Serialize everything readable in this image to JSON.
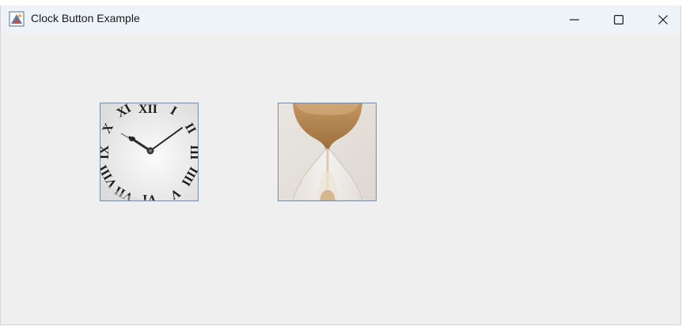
{
  "window": {
    "title": "Clock Button Example",
    "icon": "java-app-icon",
    "controls": [
      "minimize-icon",
      "maximize-icon",
      "close-icon"
    ]
  },
  "content": {
    "buttons": [
      {
        "name": "clock-button",
        "icon": "roman-clock-image"
      },
      {
        "name": "hourglass-button",
        "icon": "hourglass-image"
      }
    ]
  },
  "colors": {
    "titlebar_bg": "#eef2f9",
    "content_bg": "#efefef",
    "button_border": "#7a8ca3",
    "sand": "#b98b55"
  }
}
